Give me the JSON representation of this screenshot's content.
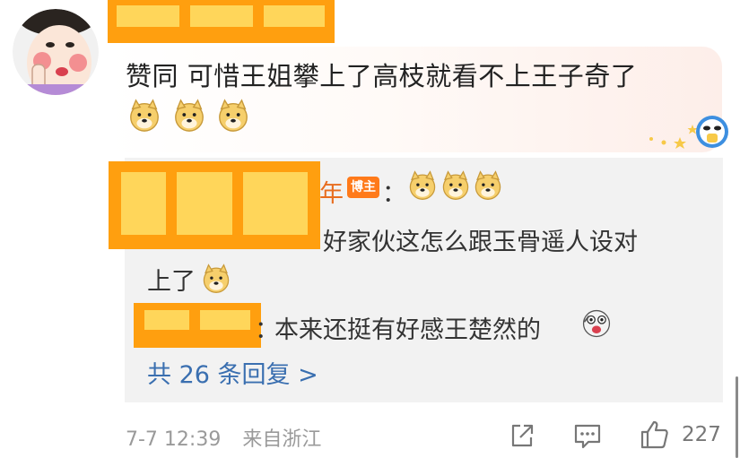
{
  "comment": {
    "text": "赞同 可惜王姐攀上了高枝就看不上王子奇了",
    "emoji_icon": "doge-icon",
    "emoji_count": 3
  },
  "replies": [
    {
      "name_suffix": "年",
      "badge": "博主",
      "separator": "：",
      "text_line1": "好家伙这怎么跟玉骨遥人设对",
      "text_line2": "上了"
    },
    {
      "separator": "：",
      "text": "本来还挺有好感王楚然的"
    }
  ],
  "more_replies": "共 26 条回复 >",
  "footer": {
    "time": "7-7 12:39",
    "location": "来自浙江",
    "like_count": "227"
  },
  "colors": {
    "redaction": "#ff9f0f",
    "link": "#3a6fb0",
    "badge": "#ff7a1a",
    "reply_bg": "#f2f2f2"
  }
}
